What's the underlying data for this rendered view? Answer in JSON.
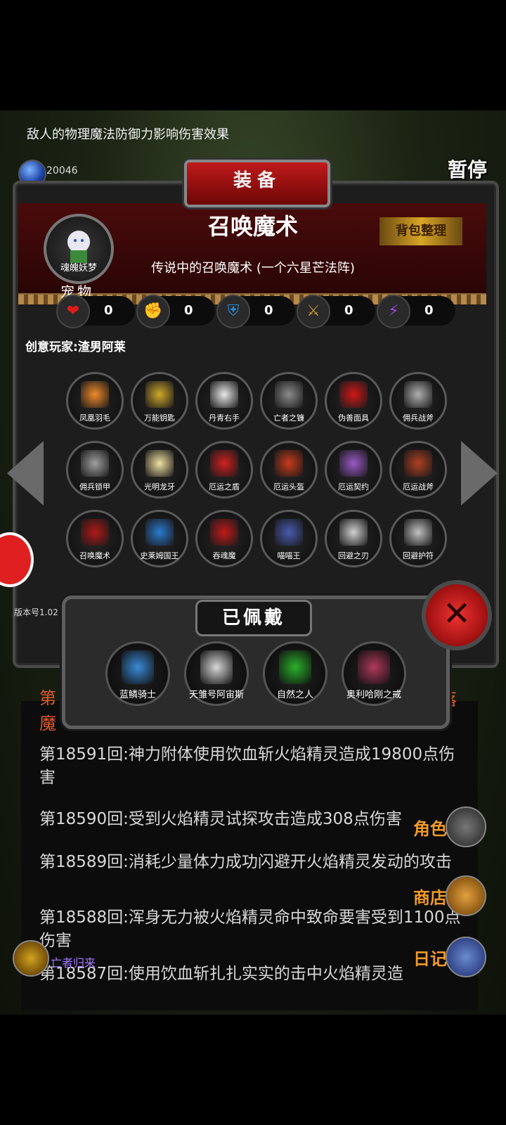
{
  "top": {
    "tip": "敌人的物理魔法防御力影响伤害效果",
    "gem_value": "20046",
    "pause_label": "暂停"
  },
  "panel": {
    "banner": "装备",
    "pet_name": "魂魄妖梦",
    "pet_label": "宠物",
    "item_title": "召唤魔术",
    "item_desc": "传说中的召唤魔术 (一个六星芒法阵)",
    "sort_button": "背包整理",
    "stats": [
      {
        "icon": "heart-icon",
        "value": "0",
        "color": "#e01a1a"
      },
      {
        "icon": "strength-icon",
        "value": "0",
        "color": "#e6c21a"
      },
      {
        "icon": "armor-icon",
        "value": "0",
        "color": "#2a8bd6"
      },
      {
        "icon": "weapon-icon",
        "value": "0",
        "color": "#c79a2a"
      },
      {
        "icon": "magic-icon",
        "value": "0",
        "color": "#a04ae0"
      }
    ],
    "creator": "创意玩家:渣男阿莱",
    "items": [
      {
        "name": "凤凰羽毛",
        "color": "#f08a2a"
      },
      {
        "name": "万能钥匙",
        "color": "#d0a92a"
      },
      {
        "name": "丹青右手",
        "color": "#e8e8e8"
      },
      {
        "name": "亡者之镰",
        "color": "#8a8a8a"
      },
      {
        "name": "伪善面具",
        "color": "#d01818"
      },
      {
        "name": "佣兵战斧",
        "color": "#b0b0b0"
      },
      {
        "name": "佣兵锁甲",
        "color": "#a0a0a0"
      },
      {
        "name": "光明龙牙",
        "color": "#f0e0a0"
      },
      {
        "name": "厄运之盾",
        "color": "#d02020"
      },
      {
        "name": "厄运头盔",
        "color": "#c83a1a"
      },
      {
        "name": "厄运契约",
        "color": "#9a5ac8"
      },
      {
        "name": "厄运战斧",
        "color": "#b04020"
      },
      {
        "name": "召唤魔术",
        "color": "#b01818"
      },
      {
        "name": "史莱姆国王",
        "color": "#2a7ad0"
      },
      {
        "name": "吞魂魔",
        "color": "#c01a1a"
      },
      {
        "name": "喵喵王",
        "color": "#4a5ab0"
      },
      {
        "name": "回避之刃",
        "color": "#d0d0d0"
      },
      {
        "name": "回避护符",
        "color": "#c0c0c0"
      }
    ],
    "version": "版本号1.02"
  },
  "worn": {
    "title": "已佩戴",
    "items": [
      {
        "name": "蓝鳞骑士",
        "color": "#3a8ad6"
      },
      {
        "name": "天雏号阿宙斯",
        "color": "#d8d8d8"
      },
      {
        "name": "自然之人",
        "color": "#2ab02a"
      },
      {
        "name": "奥利哈刚之戒",
        "color": "#b03a5a"
      }
    ]
  },
  "log": {
    "partial_left": "第魔",
    "partial_right": "落",
    "lines": [
      "第18591回:神力附体使用饮血斩火焰精灵造成19800点伤害",
      "第18590回:受到火焰精灵试探攻击造成308点伤害",
      "第18589回:消耗少量体力成功闪避开火焰精灵发动的攻击",
      "第18588回:浑身无力被火焰精灵命中致命要害受到1100点伤害",
      "第18587回:使用饮血斩扎扎实实的击中火焰精灵造"
    ]
  },
  "side": {
    "role": "角色",
    "shop": "商店",
    "diary": "日记"
  },
  "player": {
    "name": "亡者归来"
  }
}
